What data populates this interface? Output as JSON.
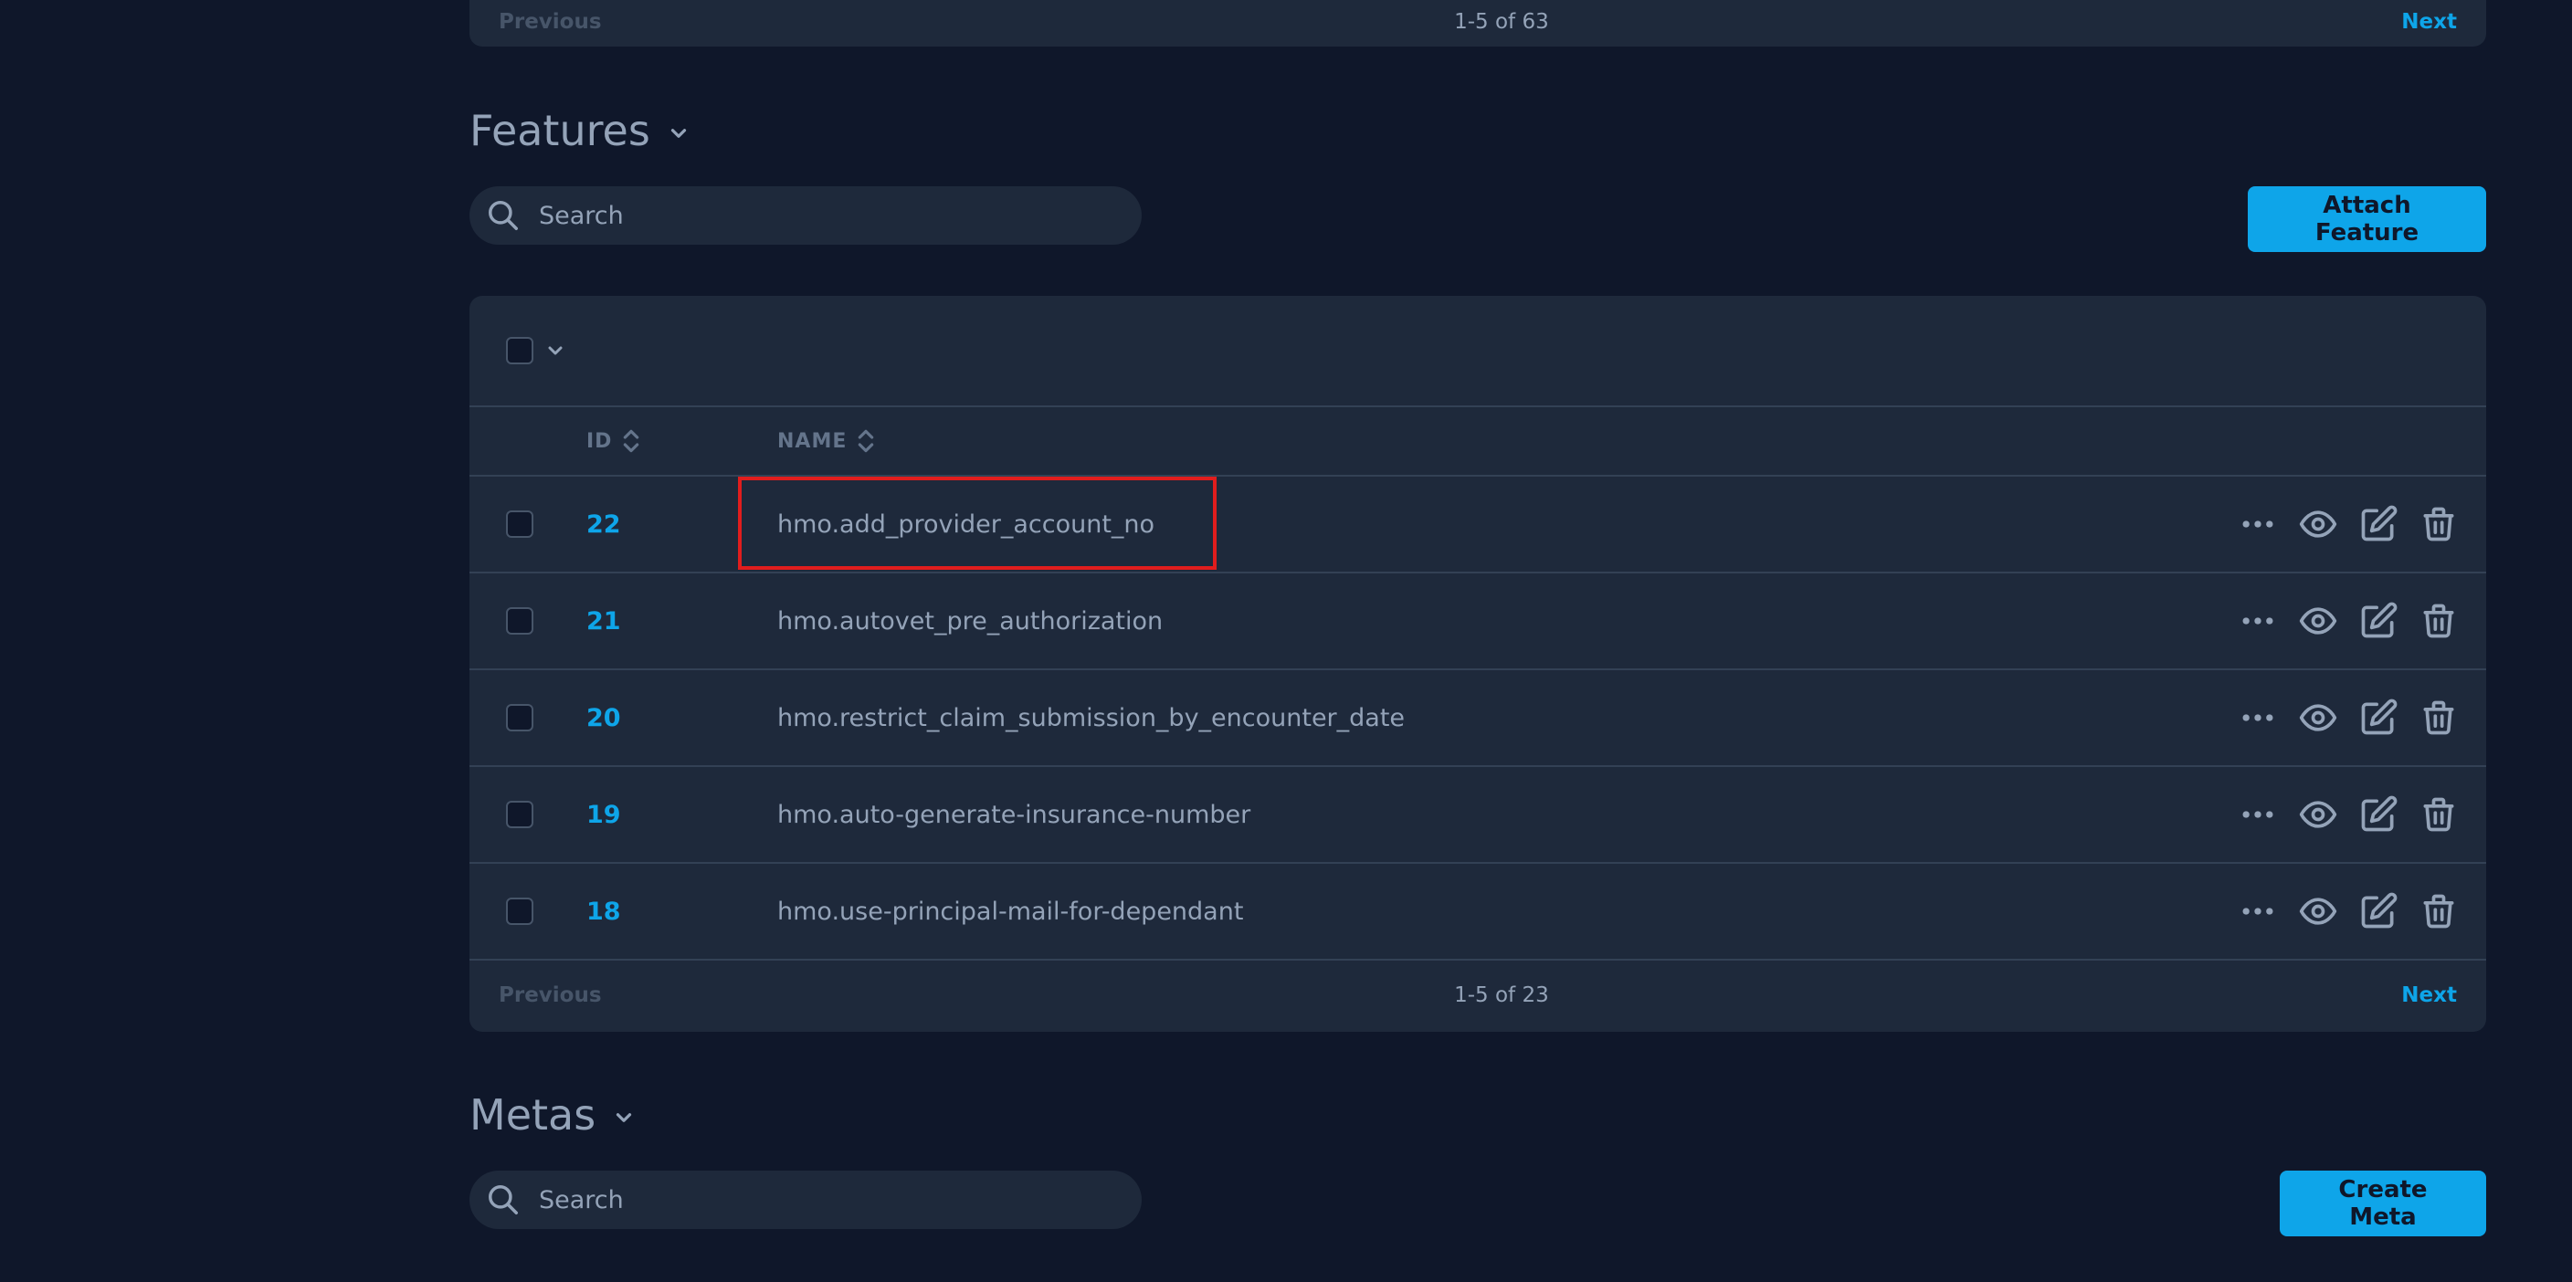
{
  "top_pager": {
    "previous_label": "Previous",
    "count": "1-5 of 63",
    "next_label": "Next"
  },
  "features": {
    "title": "Features",
    "search_placeholder": "Search",
    "attach_button": "Attach Feature",
    "columns": {
      "id": "ID",
      "name": "NAME"
    },
    "rows": [
      {
        "id": "22",
        "name": "hmo.add_provider_account_no"
      },
      {
        "id": "21",
        "name": "hmo.autovet_pre_authorization"
      },
      {
        "id": "20",
        "name": "hmo.restrict_claim_submission_by_encounter_date"
      },
      {
        "id": "19",
        "name": "hmo.auto-generate-insurance-number"
      },
      {
        "id": "18",
        "name": "hmo.use-principal-mail-for-dependant"
      }
    ],
    "pager": {
      "previous_label": "Previous",
      "count": "1-5 of 23",
      "next_label": "Next"
    }
  },
  "metas": {
    "title": "Metas",
    "search_placeholder": "Search",
    "create_button": "Create Meta"
  },
  "colors": {
    "background": "#0f172a",
    "panel": "#1e293b",
    "accent": "#0ea5e9",
    "highlight": "#e11d1d"
  }
}
